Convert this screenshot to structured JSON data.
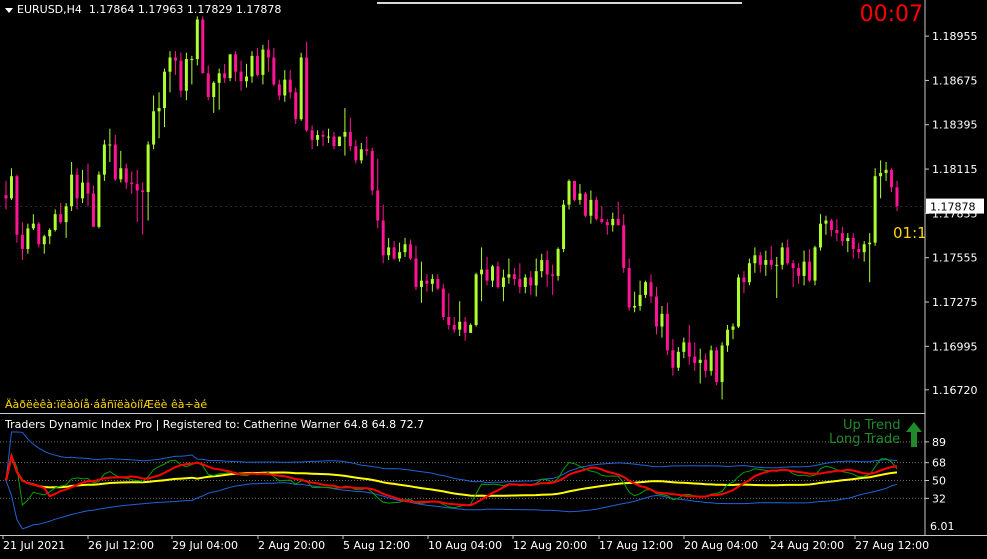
{
  "header": {
    "symbol": "EURUSD,H4",
    "ohlc": "1.17864 1.17963 1.17829 1.17878"
  },
  "countdown": "00:07",
  "bar_timer": "01:1",
  "garbled_label": "Äàðëèêà:ïëàòíå·áåñïëàòíîÆëè êà÷àé",
  "current_price": "1.17878",
  "price_axis": [
    "1.18955",
    "1.18675",
    "1.18395",
    "1.18115",
    "1.17835",
    "1.17555",
    "1.17275",
    "1.16995",
    "1.16720"
  ],
  "indicator": {
    "header": "Traders Dynamic Index Pro | Registered to: Catherine Warner 64.8 64.8 72.7",
    "levels": [
      "89",
      "68",
      "50",
      "32"
    ],
    "bottom_label": "6.01",
    "up_trend": "Up Trend",
    "long_trade": "Long Trade"
  },
  "time_axis": [
    "21 Jul 2021",
    "26 Jul 12:00",
    "29 Jul 04:00",
    "2 Aug 20:00",
    "5 Aug 12:00",
    "10 Aug 04:00",
    "12 Aug 20:00",
    "17 Aug 12:00",
    "20 Aug 04:00",
    "24 Aug 20:00",
    "27 Aug 12:00"
  ],
  "colors": {
    "bull": "#adff2f",
    "bear": "#ff1493",
    "tdi_red": "#ff0000",
    "tdi_green": "#00a000",
    "tdi_yellow": "#ffff00",
    "tdi_blue": "#1e64d8",
    "arrow": "#1f8b2a"
  },
  "chart_data": {
    "type": "candlestick",
    "symbol": "EURUSD",
    "timeframe": "H4",
    "ylim": [
      1.1658,
      1.1912
    ],
    "candles": [
      [
        1.1795,
        1.1804,
        1.1786,
        1.1793
      ],
      [
        1.1793,
        1.1812,
        1.1792,
        1.1807
      ],
      [
        1.1807,
        1.1808,
        1.1765,
        1.177
      ],
      [
        1.177,
        1.1778,
        1.1754,
        1.1761
      ],
      [
        1.1761,
        1.1777,
        1.1758,
        1.1774
      ],
      [
        1.1774,
        1.1783,
        1.1773,
        1.1777
      ],
      [
        1.1777,
        1.1778,
        1.1762,
        1.1764
      ],
      [
        1.1764,
        1.177,
        1.1758,
        1.1769
      ],
      [
        1.1769,
        1.1774,
        1.1764,
        1.1773
      ],
      [
        1.1773,
        1.1786,
        1.1772,
        1.1783
      ],
      [
        1.1783,
        1.179,
        1.1777,
        1.1778
      ],
      [
        1.1778,
        1.179,
        1.1768,
        1.1788
      ],
      [
        1.1788,
        1.1816,
        1.1785,
        1.1808
      ],
      [
        1.1808,
        1.1812,
        1.1786,
        1.1793
      ],
      [
        1.1793,
        1.1811,
        1.179,
        1.1803
      ],
      [
        1.1803,
        1.1815,
        1.1788,
        1.1796
      ],
      [
        1.1796,
        1.1801,
        1.1775,
        1.1775
      ],
      [
        1.1775,
        1.181,
        1.1774,
        1.1808
      ],
      [
        1.1808,
        1.183,
        1.1804,
        1.1827
      ],
      [
        1.1827,
        1.1837,
        1.1816,
        1.1827
      ],
      [
        1.1827,
        1.1833,
        1.1804,
        1.1805
      ],
      [
        1.1805,
        1.1823,
        1.1803,
        1.1812
      ],
      [
        1.1812,
        1.1815,
        1.1799,
        1.1803
      ],
      [
        1.1803,
        1.181,
        1.1796,
        1.1802
      ],
      [
        1.1802,
        1.1811,
        1.1778,
        1.1798
      ],
      [
        1.1798,
        1.1803,
        1.177,
        1.1797
      ],
      [
        1.1797,
        1.1829,
        1.1779,
        1.1827
      ],
      [
        1.1827,
        1.1858,
        1.1824,
        1.1848
      ],
      [
        1.1848,
        1.186,
        1.1831,
        1.185
      ],
      [
        1.185,
        1.1875,
        1.1838,
        1.1873
      ],
      [
        1.1873,
        1.1886,
        1.186,
        1.1882
      ],
      [
        1.1882,
        1.1886,
        1.1871,
        1.188
      ],
      [
        1.188,
        1.1885,
        1.1857,
        1.1861
      ],
      [
        1.1861,
        1.1885,
        1.1855,
        1.1881
      ],
      [
        1.1881,
        1.1883,
        1.1865,
        1.1881
      ],
      [
        1.1881,
        1.1908,
        1.1877,
        1.1906
      ],
      [
        1.1906,
        1.1908,
        1.1872,
        1.1872
      ],
      [
        1.1872,
        1.1877,
        1.1855,
        1.1857
      ],
      [
        1.1857,
        1.1867,
        1.1847,
        1.1866
      ],
      [
        1.1866,
        1.1875,
        1.1849,
        1.1872
      ],
      [
        1.1872,
        1.1878,
        1.1866,
        1.1869
      ],
      [
        1.1869,
        1.1884,
        1.1867,
        1.1884
      ],
      [
        1.1884,
        1.1886,
        1.1867,
        1.1873
      ],
      [
        1.1873,
        1.188,
        1.1861,
        1.1867
      ],
      [
        1.1867,
        1.1878,
        1.1863,
        1.187
      ],
      [
        1.187,
        1.1886,
        1.1866,
        1.1883
      ],
      [
        1.1883,
        1.1888,
        1.187,
        1.1871
      ],
      [
        1.1871,
        1.189,
        1.1865,
        1.1887
      ],
      [
        1.1887,
        1.1893,
        1.1873,
        1.1882
      ],
      [
        1.1882,
        1.1888,
        1.1864,
        1.1865
      ],
      [
        1.1865,
        1.1868,
        1.1855,
        1.1858
      ],
      [
        1.1858,
        1.1874,
        1.1854,
        1.1868
      ],
      [
        1.1868,
        1.1874,
        1.1856,
        1.186
      ],
      [
        1.186,
        1.1863,
        1.184,
        1.1843
      ],
      [
        1.1843,
        1.1885,
        1.1842,
        1.1882
      ],
      [
        1.1882,
        1.1892,
        1.1835,
        1.1836
      ],
      [
        1.1836,
        1.1839,
        1.1824,
        1.183
      ],
      [
        1.183,
        1.1836,
        1.1826,
        1.1833
      ],
      [
        1.1833,
        1.1836,
        1.1826,
        1.1832
      ],
      [
        1.1832,
        1.1837,
        1.1828,
        1.1832
      ],
      [
        1.1832,
        1.1835,
        1.1824,
        1.1826
      ],
      [
        1.1826,
        1.1832,
        1.1826,
        1.1832
      ],
      [
        1.1832,
        1.185,
        1.182,
        1.1835
      ],
      [
        1.1835,
        1.1844,
        1.1823,
        1.1826
      ],
      [
        1.1826,
        1.183,
        1.1815,
        1.1817
      ],
      [
        1.1817,
        1.1828,
        1.1815,
        1.1824
      ],
      [
        1.1824,
        1.1832,
        1.182,
        1.1823
      ],
      [
        1.1823,
        1.1825,
        1.1795,
        1.1798
      ],
      [
        1.1798,
        1.1818,
        1.1774,
        1.1779
      ],
      [
        1.1779,
        1.1789,
        1.1752,
        1.1757
      ],
      [
        1.1757,
        1.1768,
        1.1754,
        1.1762
      ],
      [
        1.1762,
        1.1766,
        1.1754,
        1.1755
      ],
      [
        1.1755,
        1.1765,
        1.1753,
        1.1759
      ],
      [
        1.1759,
        1.1768,
        1.1756,
        1.1764
      ],
      [
        1.1764,
        1.1767,
        1.1754,
        1.1755
      ],
      [
        1.1755,
        1.1763,
        1.1735,
        1.1737
      ],
      [
        1.1737,
        1.1753,
        1.1727,
        1.1741
      ],
      [
        1.1741,
        1.1745,
        1.1734,
        1.1739
      ],
      [
        1.1739,
        1.1745,
        1.1734,
        1.1742
      ],
      [
        1.1742,
        1.1745,
        1.1735,
        1.1736
      ],
      [
        1.1736,
        1.1739,
        1.1716,
        1.1718
      ],
      [
        1.1718,
        1.1733,
        1.171,
        1.1713
      ],
      [
        1.1713,
        1.1718,
        1.1708,
        1.171
      ],
      [
        1.171,
        1.1728,
        1.1706,
        1.1715
      ],
      [
        1.1715,
        1.1718,
        1.1703,
        1.1708
      ],
      [
        1.1708,
        1.1714,
        1.1708,
        1.1713
      ],
      [
        1.1713,
        1.1746,
        1.1712,
        1.1745
      ],
      [
        1.1745,
        1.1762,
        1.1728,
        1.1748
      ],
      [
        1.1748,
        1.1756,
        1.1738,
        1.1741
      ],
      [
        1.1741,
        1.1751,
        1.1737,
        1.175
      ],
      [
        1.175,
        1.1753,
        1.1736,
        1.1737
      ],
      [
        1.1737,
        1.1748,
        1.1728,
        1.1743
      ],
      [
        1.1743,
        1.1755,
        1.1739,
        1.1745
      ],
      [
        1.1745,
        1.1749,
        1.1738,
        1.1742
      ],
      [
        1.1742,
        1.1752,
        1.1733,
        1.1737
      ],
      [
        1.1737,
        1.1745,
        1.1733,
        1.1743
      ],
      [
        1.1743,
        1.1747,
        1.1732,
        1.1738
      ],
      [
        1.1738,
        1.1755,
        1.1731,
        1.1747
      ],
      [
        1.1747,
        1.1758,
        1.1743,
        1.1754
      ],
      [
        1.1754,
        1.176,
        1.1737,
        1.1745
      ],
      [
        1.1745,
        1.1751,
        1.1732,
        1.1744
      ],
      [
        1.1744,
        1.1762,
        1.1741,
        1.1761
      ],
      [
        1.1761,
        1.1792,
        1.1759,
        1.1789
      ],
      [
        1.1789,
        1.1805,
        1.1786,
        1.1804
      ],
      [
        1.1804,
        1.1804,
        1.1791,
        1.1792
      ],
      [
        1.1792,
        1.1802,
        1.1789,
        1.1796
      ],
      [
        1.1796,
        1.1797,
        1.1781,
        1.1782
      ],
      [
        1.1782,
        1.1798,
        1.1777,
        1.1792
      ],
      [
        1.1792,
        1.1794,
        1.1779,
        1.178
      ],
      [
        1.178,
        1.1788,
        1.1777,
        1.1778
      ],
      [
        1.1778,
        1.178,
        1.177,
        1.1776
      ],
      [
        1.1776,
        1.1784,
        1.1772,
        1.178
      ],
      [
        1.178,
        1.1791,
        1.1776,
        1.1776
      ],
      [
        1.1776,
        1.1783,
        1.1746,
        1.1749
      ],
      [
        1.1749,
        1.1755,
        1.1722,
        1.1724
      ],
      [
        1.1724,
        1.1734,
        1.1721,
        1.1725
      ],
      [
        1.1725,
        1.1741,
        1.1722,
        1.1732
      ],
      [
        1.1732,
        1.1741,
        1.173,
        1.174
      ],
      [
        1.174,
        1.1745,
        1.1727,
        1.1731
      ],
      [
        1.1731,
        1.1737,
        1.1707,
        1.1712
      ],
      [
        1.1712,
        1.1725,
        1.1705,
        1.172
      ],
      [
        1.172,
        1.1727,
        1.1694,
        1.1697
      ],
      [
        1.1697,
        1.1704,
        1.1681,
        1.1686
      ],
      [
        1.1686,
        1.1699,
        1.1684,
        1.1696
      ],
      [
        1.1696,
        1.1705,
        1.1692,
        1.1702
      ],
      [
        1.1702,
        1.1713,
        1.1688,
        1.1693
      ],
      [
        1.1693,
        1.1702,
        1.1684,
        1.1689
      ],
      [
        1.1689,
        1.1698,
        1.1676,
        1.1691
      ],
      [
        1.1691,
        1.1695,
        1.168,
        1.1684
      ],
      [
        1.1684,
        1.17,
        1.1681,
        1.1697
      ],
      [
        1.1697,
        1.1699,
        1.1675,
        1.1677
      ],
      [
        1.1677,
        1.1702,
        1.1666,
        1.17
      ],
      [
        1.17,
        1.1713,
        1.1696,
        1.171
      ],
      [
        1.171,
        1.1714,
        1.1704,
        1.1712
      ],
      [
        1.1712,
        1.1745,
        1.1711,
        1.1743
      ],
      [
        1.1743,
        1.1747,
        1.1733,
        1.174
      ],
      [
        1.174,
        1.1755,
        1.1738,
        1.1752
      ],
      [
        1.1752,
        1.1762,
        1.1746,
        1.1757
      ],
      [
        1.1757,
        1.1759,
        1.1746,
        1.1751
      ],
      [
        1.1751,
        1.176,
        1.1744,
        1.1754
      ],
      [
        1.1754,
        1.1763,
        1.1748,
        1.1751
      ],
      [
        1.1751,
        1.1756,
        1.173,
        1.1751
      ],
      [
        1.1751,
        1.1765,
        1.1748,
        1.1762
      ],
      [
        1.1762,
        1.1767,
        1.1751,
        1.1752
      ],
      [
        1.1752,
        1.1754,
        1.1737,
        1.1749
      ],
      [
        1.1749,
        1.1752,
        1.1739,
        1.1744
      ],
      [
        1.1744,
        1.176,
        1.1738,
        1.1753
      ],
      [
        1.1753,
        1.1761,
        1.174,
        1.1741
      ],
      [
        1.1741,
        1.1763,
        1.1738,
        1.1762
      ],
      [
        1.1762,
        1.1783,
        1.176,
        1.1777
      ],
      [
        1.1777,
        1.1782,
        1.177,
        1.1779
      ],
      [
        1.1779,
        1.178,
        1.1769,
        1.1773
      ],
      [
        1.1773,
        1.178,
        1.1766,
        1.1771
      ],
      [
        1.1771,
        1.1775,
        1.1763,
        1.1766
      ],
      [
        1.1766,
        1.1771,
        1.1759,
        1.1768
      ],
      [
        1.1768,
        1.1771,
        1.1755,
        1.1761
      ],
      [
        1.1761,
        1.1765,
        1.1755,
        1.1759
      ],
      [
        1.1759,
        1.1766,
        1.1753,
        1.1764
      ],
      [
        1.1764,
        1.1771,
        1.174,
        1.1765
      ],
      [
        1.1765,
        1.1812,
        1.1763,
        1.1807
      ],
      [
        1.1807,
        1.1817,
        1.1793,
        1.1809
      ],
      [
        1.1809,
        1.1816,
        1.1804,
        1.1811
      ],
      [
        1.1811,
        1.1812,
        1.1797,
        1.18
      ],
      [
        1.18,
        1.1804,
        1.1785,
        1.1788
      ]
    ],
    "tdi": {
      "levels": [
        89,
        68,
        50,
        32
      ],
      "last_values": [
        64.8,
        64.8,
        72.7
      ]
    }
  }
}
